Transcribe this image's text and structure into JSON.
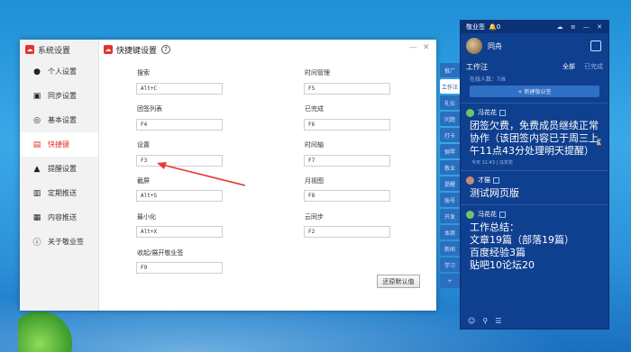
{
  "sidebar": {
    "title": "系统设置",
    "items": [
      {
        "label": "个人设置",
        "icon": "person-icon",
        "glyph": "●"
      },
      {
        "label": "同步设置",
        "icon": "sync-icon",
        "glyph": "▣"
      },
      {
        "label": "基本设置",
        "icon": "settings-icon",
        "glyph": "◎"
      },
      {
        "label": "快捷键",
        "icon": "keyboard-icon",
        "glyph": "▤"
      },
      {
        "label": "提醒设置",
        "icon": "bell-icon",
        "glyph": "▲"
      },
      {
        "label": "定期推送",
        "icon": "schedule-icon",
        "glyph": "▥"
      },
      {
        "label": "内容推送",
        "icon": "push-icon",
        "glyph": "▦"
      },
      {
        "label": "关于敬业签",
        "icon": "info-icon",
        "glyph": "ⓘ"
      }
    ]
  },
  "panel": {
    "title": "快捷键设置",
    "help": "?",
    "restore_label": "还原默认值",
    "shortcuts": [
      {
        "label": "搜索",
        "value": "Alt+C"
      },
      {
        "label": "时间管理",
        "value": "F5"
      },
      {
        "label": "团签列表",
        "value": "F4"
      },
      {
        "label": "已完成",
        "value": "F6"
      },
      {
        "label": "设置",
        "value": "F3"
      },
      {
        "label": "时间轴",
        "value": "F7"
      },
      {
        "label": "截屏",
        "value": "Alt+S"
      },
      {
        "label": "月视图",
        "value": "F8"
      },
      {
        "label": "最小化",
        "value": "Alt+X"
      },
      {
        "label": "云同步",
        "value": "F2"
      },
      {
        "label": "收起/展开敬业签",
        "value": "F9"
      }
    ]
  },
  "note": {
    "app_title": "敬业签",
    "badge": "0",
    "user": "同舟",
    "group_name": "工作汪",
    "filter_all": "全部",
    "filter_done": "已完成",
    "online": "在线人数：7/8",
    "add_label": "+ 新建敬业签",
    "items": [
      {
        "author": "冯花花",
        "text": "团签欠费，免费成员继续正常协作（该团签内容已于周三上午11点43分处理明天提醒）",
        "meta": "今天 11:43 | 冯花花"
      },
      {
        "author": "才猫",
        "text": "测试网页版",
        "meta": ""
      },
      {
        "author": "冯花花",
        "text": "工作总结：\n文章19篇（部落19篇）\n百度经验3篇\n贴吧10论坛20",
        "meta": ""
      }
    ],
    "side_tabs": [
      "推广",
      "工作汪",
      "礼仪",
      "问题",
      "打卡",
      "钢琴",
      "敬业",
      "提醒",
      "账号",
      "开发",
      "本周",
      "新闻",
      "学习"
    ]
  },
  "colors": {
    "accent": "#e5342e",
    "note_bg": "#0f3f8f"
  }
}
